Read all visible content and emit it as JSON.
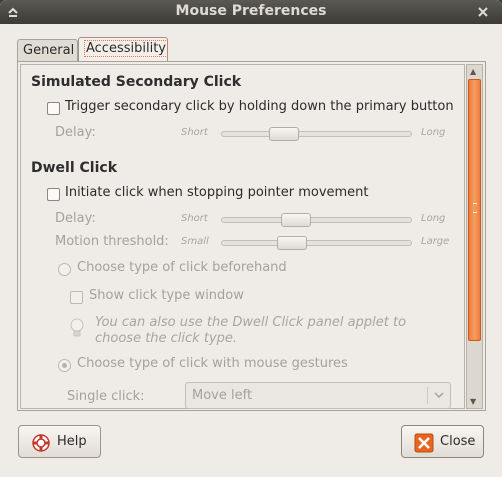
{
  "window": {
    "title": "Mouse Preferences",
    "menu_icon": "window-menu-icon",
    "close_icon": "window-close-icon"
  },
  "tabs": [
    {
      "label": "General",
      "active": false
    },
    {
      "label": "Accessibility",
      "active": true
    }
  ],
  "secondary_click": {
    "title": "Simulated Secondary Click",
    "checkbox_label": "Trigger secondary click by holding down the primary button",
    "checked": false,
    "delay": {
      "label": "Delay:",
      "min_label": "Short",
      "max_label": "Long",
      "level": 0.3
    }
  },
  "dwell_click": {
    "title": "Dwell Click",
    "checkbox_label": "Initiate click when stopping pointer movement",
    "checked": false,
    "delay": {
      "label": "Delay:",
      "min_label": "Short",
      "max_label": "Long",
      "level": 0.37
    },
    "motion_threshold": {
      "label": "Motion threshold:",
      "min_label": "Small",
      "max_label": "Large",
      "level": 0.35
    },
    "choose_beforehand_label": "Choose type of click beforehand",
    "show_window_label": "Show click type window",
    "note": "You can also use the Dwell Click panel applet to choose the click type.",
    "choose_gestures_label": "Choose type of click with mouse gestures",
    "single_click_label": "Single click:",
    "single_click_value": "Move left"
  },
  "buttons": {
    "help": "Help",
    "close": "Close"
  },
  "colors": {
    "accent": "#f57a3d",
    "titlebar": "#3c3b37",
    "close_icon": "#e05a1a"
  }
}
